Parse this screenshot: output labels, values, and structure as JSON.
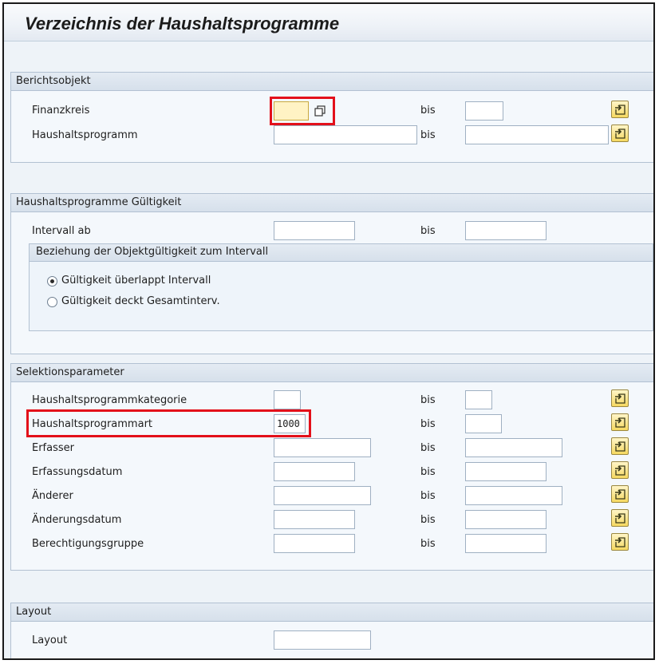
{
  "title": "Verzeichnis der Haushaltsprogramme",
  "bis_label": "bis",
  "berichtsobjekt": {
    "header": "Berichtsobjekt",
    "rows": [
      {
        "label": "Finanzkreis",
        "value_from": "",
        "value_to": ""
      },
      {
        "label": "Haushaltsprogramm",
        "value_from": "",
        "value_to": ""
      }
    ]
  },
  "gueltigkeit": {
    "header": "Haushaltsprogramme Gültigkeit",
    "intervall_label": "Intervall ab",
    "intervall_from": "",
    "intervall_to": "",
    "beziehung": {
      "header": "Beziehung der Objektgültigkeit zum Intervall",
      "options": [
        {
          "label": "Gültigkeit überlappt Intervall",
          "selected": true
        },
        {
          "label": "Gültigkeit deckt Gesamtinterv.",
          "selected": false
        }
      ]
    }
  },
  "selektion": {
    "header": "Selektionsparameter",
    "rows": [
      {
        "label": "Haushaltsprogrammkategorie",
        "value_from": "",
        "value_to": ""
      },
      {
        "label": "Haushaltsprogrammart",
        "value_from": "1000",
        "value_to": ""
      },
      {
        "label": "Erfasser",
        "value_from": "",
        "value_to": ""
      },
      {
        "label": "Erfassungsdatum",
        "value_from": "",
        "value_to": ""
      },
      {
        "label": "Änderer",
        "value_from": "",
        "value_to": ""
      },
      {
        "label": "Änderungsdatum",
        "value_from": "",
        "value_to": ""
      },
      {
        "label": "Berechtigungsgruppe",
        "value_from": "",
        "value_to": ""
      }
    ]
  },
  "layout": {
    "header": "Layout",
    "label": "Layout",
    "value": ""
  },
  "colors": {
    "highlight": "#e3101a",
    "focused_field": "#fff3c4",
    "multi_button": "#f6d961"
  },
  "icons": {
    "multiple_selection": "arrow-right-into-box-icon",
    "f4_help": "two-windows-icon"
  }
}
